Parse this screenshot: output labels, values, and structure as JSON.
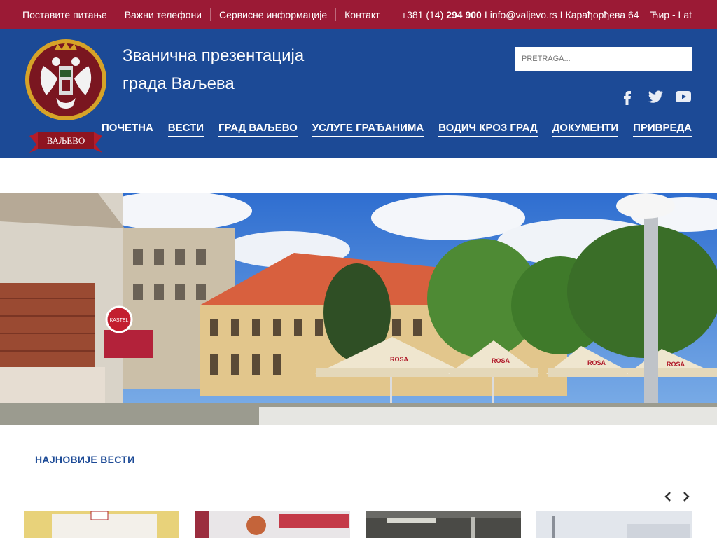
{
  "topbar": {
    "links": [
      "Поставите питање",
      "Важни телефони",
      "Сервисне информације",
      "Контакт"
    ],
    "phone_prefix": "+381 (14)",
    "phone_number": "294 900",
    "separator": "I",
    "email": "info@valjevo.rs",
    "address": "Карађорђева 64",
    "language": "Ћир - Lat"
  },
  "header": {
    "title_line1": "Званична презентација",
    "title_line2": "града Ваљева",
    "logo_text": "ВАЉЕВО",
    "search_placeholder": "PRETRAGA...",
    "social_icons": [
      "facebook-icon",
      "twitter-icon",
      "youtube-icon"
    ]
  },
  "nav": {
    "items": [
      "ПОЧЕТНА",
      "ВЕСТИ",
      "ГРАД ВАЉЕВО",
      "УСЛУГЕ ГРАЂАНИМА",
      "ВОДИЧ КРОЗ ГРАД",
      "ДОКУМЕНТИ",
      "ПРИВРЕДА"
    ]
  },
  "hero": {
    "umbrella_text": "ROSA",
    "sign_text": "KASTEL"
  },
  "news": {
    "heading": "НАЈНОВИЈЕ ВЕСТИ"
  },
  "colors": {
    "topbar": "#9b1a35",
    "header": "#1c4a96",
    "heading": "#1c4a96"
  }
}
